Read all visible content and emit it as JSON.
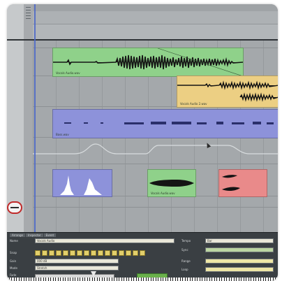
{
  "app": {
    "accent": "#4a66c8"
  },
  "clips": [
    {
      "label": "Vocals Audio.wav",
      "color": "#8fd18a",
      "waveform": "dense"
    },
    {
      "label": "Vocals Audio 2.wav",
      "color": "#eccf83",
      "waveform": "partial"
    },
    {
      "label": "Bass.wav",
      "color": "#8d92da",
      "waveform": "sparse"
    },
    {
      "label": "",
      "color": "#8d92da",
      "waveform": "spikes"
    },
    {
      "label": "Vocals Audio.wav",
      "color": "#8fd18a",
      "waveform": "blob"
    },
    {
      "label": "",
      "color": "#e98a8a",
      "waveform": "blob"
    }
  ],
  "inspector": {
    "tabs": [
      "Arrange",
      "Inspector",
      "Event"
    ],
    "rows": [
      {
        "label": "Name",
        "value": "Vocals Audio"
      },
      {
        "label": "Snap",
        "value": ""
      },
      {
        "label": "Gain",
        "value": "000 dB"
      },
      {
        "label": "Mode",
        "value": "Stretch"
      },
      {
        "label": "Fade",
        "value": ""
      }
    ],
    "right_rows": [
      {
        "label": "Tempo",
        "value": "Bar"
      },
      {
        "label": "Sync",
        "value": ""
      },
      {
        "label": "Range",
        "value": ""
      },
      {
        "label": "Loop",
        "value": ""
      }
    ],
    "key_count": 16
  }
}
